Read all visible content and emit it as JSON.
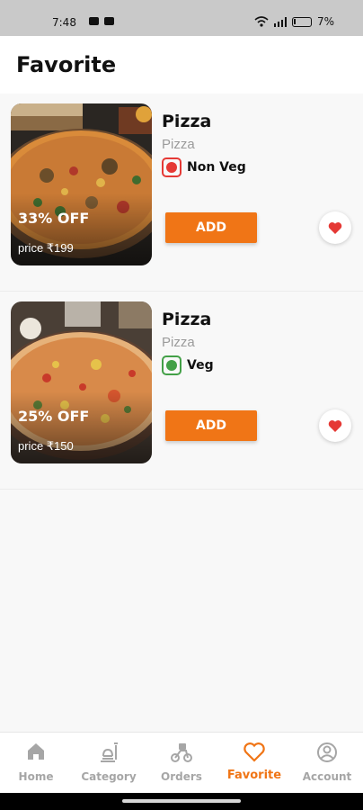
{
  "status_bar": {
    "time": "7:48",
    "battery": "7%"
  },
  "header": {
    "title": "Favorite"
  },
  "favorites": [
    {
      "name": "Pizza",
      "category": "Pizza",
      "diet": "Non Veg",
      "diet_color": "#e53935",
      "discount": "33% OFF",
      "price": "price ₹199",
      "add_label": "ADD"
    },
    {
      "name": "Pizza",
      "category": "Pizza",
      "diet": "Veg",
      "diet_color": "#43a047",
      "discount": "25% OFF",
      "price": "price ₹150",
      "add_label": "ADD"
    }
  ],
  "bottom_nav": [
    {
      "label": "Home",
      "icon": "home-icon"
    },
    {
      "label": "Category",
      "icon": "category-icon"
    },
    {
      "label": "Orders",
      "icon": "orders-icon"
    },
    {
      "label": "Favorite",
      "icon": "heart-icon",
      "active": true
    },
    {
      "label": "Account",
      "icon": "account-icon"
    }
  ],
  "colors": {
    "accent": "#f07516",
    "heart": "#e53935",
    "nav_inactive": "#a6a6a6"
  }
}
